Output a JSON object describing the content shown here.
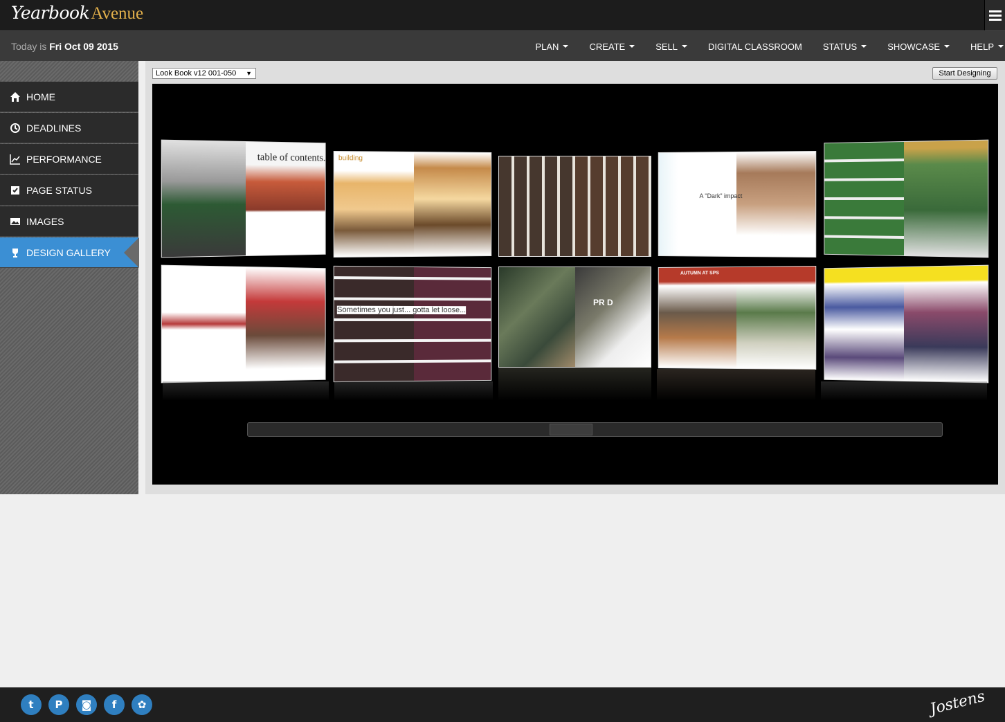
{
  "brand": {
    "name_script": "Yearbook",
    "name_plain": "Avenue"
  },
  "today": {
    "prefix": "Today is",
    "date": "Fri Oct 09 2015"
  },
  "nav": [
    {
      "label": "PLAN",
      "dropdown": true
    },
    {
      "label": "CREATE",
      "dropdown": true
    },
    {
      "label": "SELL",
      "dropdown": true
    },
    {
      "label": "DIGITAL CLASSROOM",
      "dropdown": false
    },
    {
      "label": "STATUS",
      "dropdown": true
    },
    {
      "label": "SHOWCASE",
      "dropdown": true
    },
    {
      "label": "HELP",
      "dropdown": true
    }
  ],
  "sidebar": {
    "items": [
      {
        "label": "HOME",
        "icon": "home-icon"
      },
      {
        "label": "DEADLINES",
        "icon": "clock-icon"
      },
      {
        "label": "PERFORMANCE",
        "icon": "chart-line-icon"
      },
      {
        "label": "PAGE STATUS",
        "icon": "page-check-icon"
      },
      {
        "label": "IMAGES",
        "icon": "image-icon"
      },
      {
        "label": "DESIGN GALLERY",
        "icon": "trophy-icon",
        "active": true
      }
    ]
  },
  "toolbar": {
    "book_select": "Look Book v12 001-050",
    "start_label": "Start Designing"
  },
  "gallery": {
    "spreads": [
      {
        "title": "table of contents."
      },
      {
        "title": "building"
      },
      {
        "title": ""
      },
      {
        "title": "A \"Dark\" impact"
      },
      {
        "title": ""
      },
      {
        "title": ""
      },
      {
        "title": "Sometimes you just... gotta let loose..."
      },
      {
        "title": "PR D"
      },
      {
        "title": "AUTUMN AT SPS"
      },
      {
        "title": ""
      }
    ]
  },
  "footer": {
    "social": [
      "twitter-icon",
      "pinterest-icon",
      "instagram-icon",
      "facebook-icon",
      "yearbook-app-icon"
    ],
    "company": "Jostens"
  },
  "colors": {
    "accent": "#3b8fd4",
    "gold": "#e3b04b"
  }
}
